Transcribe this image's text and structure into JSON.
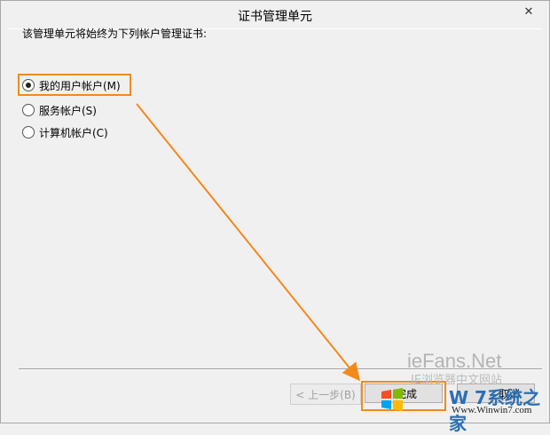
{
  "window": {
    "title": "证书管理单元"
  },
  "titlebar": {
    "close_glyph": "✕"
  },
  "prompt": "该管理单元将始终为下列帐户管理证书:",
  "options": [
    {
      "label": "我的用户帐户(M)",
      "selected": true
    },
    {
      "label": "服务帐户(S)",
      "selected": false
    },
    {
      "label": "计算机帐户(C)",
      "selected": false
    }
  ],
  "buttons": {
    "back": "< 上一步(B)",
    "finish": "完成",
    "cancel": "取消"
  },
  "watermark": {
    "brand": "ieFans.Net",
    "brand_sub": "IE浏览器中文网站",
    "site_cn": "W 7系统之家",
    "site_url": "Www.Winwin7.com"
  },
  "colors": {
    "highlight": "#f28a1a",
    "window_bg": "#f0f0f0"
  }
}
